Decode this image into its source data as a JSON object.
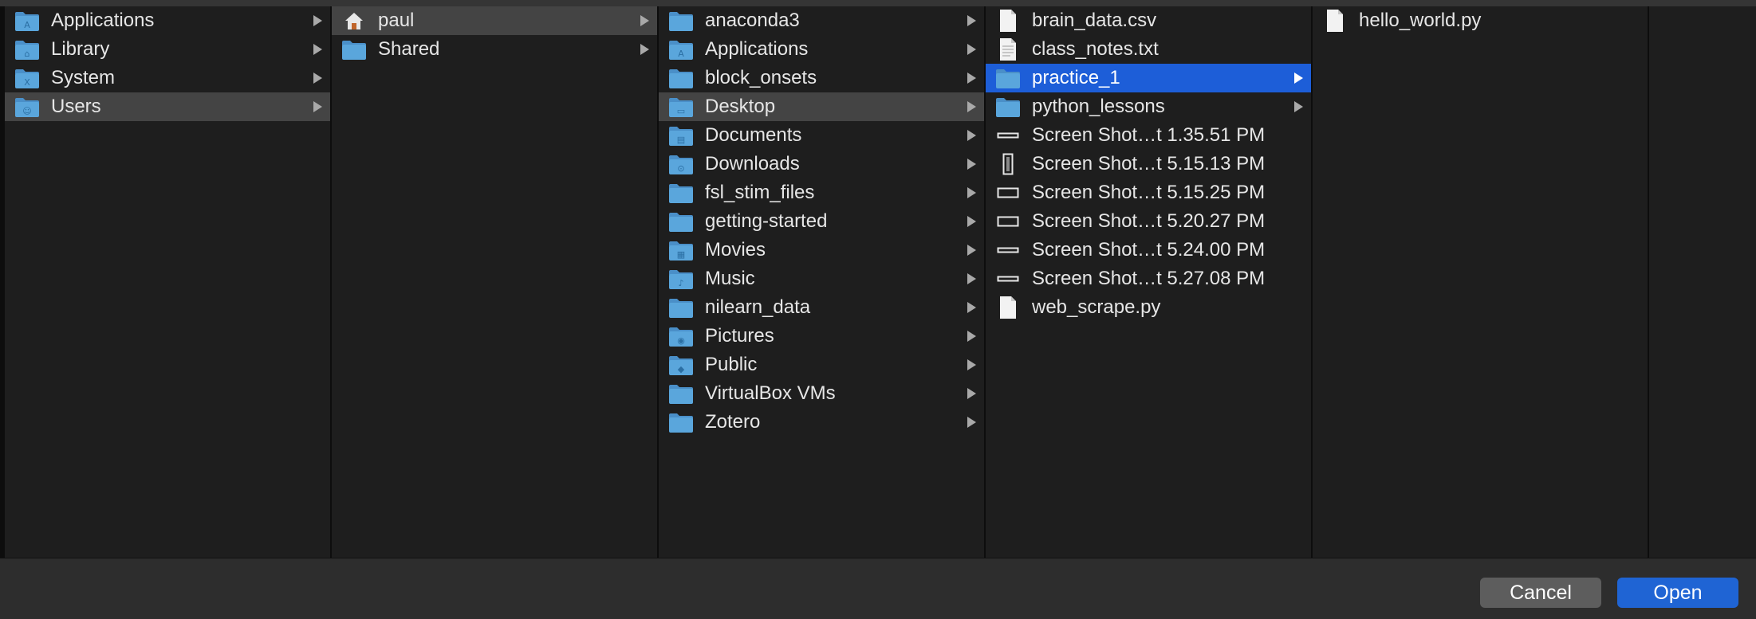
{
  "columns": [
    {
      "items": [
        {
          "label": "Applications",
          "icon": "apps-folder-icon",
          "arrow": true,
          "state": ""
        },
        {
          "label": "Library",
          "icon": "library-folder-icon",
          "arrow": true,
          "state": ""
        },
        {
          "label": "System",
          "icon": "system-folder-icon",
          "arrow": true,
          "state": ""
        },
        {
          "label": "Users",
          "icon": "users-folder-icon",
          "arrow": true,
          "state": "gray"
        }
      ]
    },
    {
      "items": [
        {
          "label": "paul",
          "icon": "home-icon",
          "arrow": true,
          "state": "gray"
        },
        {
          "label": "Shared",
          "icon": "folder-icon",
          "arrow": true,
          "state": ""
        }
      ]
    },
    {
      "items": [
        {
          "label": "anaconda3",
          "icon": "folder-icon",
          "arrow": true,
          "state": ""
        },
        {
          "label": "Applications",
          "icon": "apps-folder-icon",
          "arrow": true,
          "state": ""
        },
        {
          "label": "block_onsets",
          "icon": "folder-icon",
          "arrow": true,
          "state": ""
        },
        {
          "label": "Desktop",
          "icon": "desktop-folder-icon",
          "arrow": true,
          "state": "gray"
        },
        {
          "label": "Documents",
          "icon": "documents-folder-icon",
          "arrow": true,
          "state": ""
        },
        {
          "label": "Downloads",
          "icon": "downloads-folder-icon",
          "arrow": true,
          "state": ""
        },
        {
          "label": "fsl_stim_files",
          "icon": "folder-icon",
          "arrow": true,
          "state": ""
        },
        {
          "label": "getting-started",
          "icon": "folder-icon",
          "arrow": true,
          "state": ""
        },
        {
          "label": "Movies",
          "icon": "movies-folder-icon",
          "arrow": true,
          "state": ""
        },
        {
          "label": "Music",
          "icon": "music-folder-icon",
          "arrow": true,
          "state": ""
        },
        {
          "label": "nilearn_data",
          "icon": "folder-icon",
          "arrow": true,
          "state": ""
        },
        {
          "label": "Pictures",
          "icon": "pictures-folder-icon",
          "arrow": true,
          "state": ""
        },
        {
          "label": "Public",
          "icon": "public-folder-icon",
          "arrow": true,
          "state": ""
        },
        {
          "label": "VirtualBox VMs",
          "icon": "folder-icon",
          "arrow": true,
          "state": ""
        },
        {
          "label": "Zotero",
          "icon": "folder-icon",
          "arrow": true,
          "state": ""
        }
      ]
    },
    {
      "items": [
        {
          "label": "brain_data.csv",
          "icon": "file-icon",
          "arrow": false,
          "state": ""
        },
        {
          "label": "class_notes.txt",
          "icon": "text-file-icon",
          "arrow": false,
          "state": ""
        },
        {
          "label": "practice_1",
          "icon": "folder-icon",
          "arrow": true,
          "state": "blue"
        },
        {
          "label": "python_lessons",
          "icon": "folder-icon",
          "arrow": true,
          "state": ""
        },
        {
          "label": "Screen Shot…t 1.35.51 PM",
          "icon": "screenshot-wide-icon",
          "arrow": false,
          "state": ""
        },
        {
          "label": "Screen Shot…t 5.15.13 PM",
          "icon": "screenshot-tall-icon",
          "arrow": false,
          "state": ""
        },
        {
          "label": "Screen Shot…t 5.15.25 PM",
          "icon": "screenshot-icon",
          "arrow": false,
          "state": ""
        },
        {
          "label": "Screen Shot…t 5.20.27 PM",
          "icon": "screenshot-icon",
          "arrow": false,
          "state": ""
        },
        {
          "label": "Screen Shot…t 5.24.00 PM",
          "icon": "screenshot-wide-icon",
          "arrow": false,
          "state": ""
        },
        {
          "label": "Screen Shot…t 5.27.08 PM",
          "icon": "screenshot-wide-icon",
          "arrow": false,
          "state": ""
        },
        {
          "label": "web_scrape.py",
          "icon": "file-icon",
          "arrow": false,
          "state": ""
        }
      ]
    },
    {
      "items": [
        {
          "label": "hello_world.py",
          "icon": "file-icon",
          "arrow": false,
          "state": ""
        }
      ]
    }
  ],
  "buttons": {
    "cancel": "Cancel",
    "open": "Open"
  },
  "colors": {
    "selection_blue": "#1d5ed8",
    "selection_gray": "#444444",
    "folder_blue": "#5aa6dc"
  }
}
